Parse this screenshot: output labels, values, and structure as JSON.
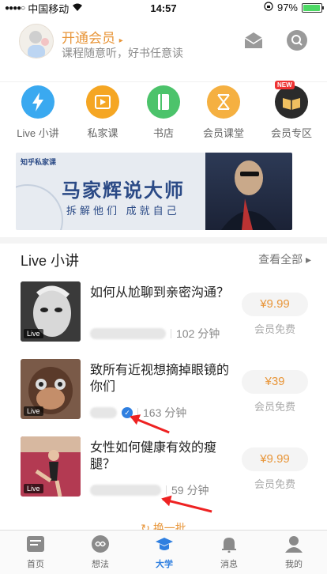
{
  "status_bar": {
    "signal": "●●●●○",
    "carrier": "中国移动",
    "time": "14:57",
    "battery": "97%"
  },
  "header": {
    "title": "开通会员",
    "subtitle": "课程随意听，好书任意读"
  },
  "shortcuts": [
    {
      "label": "Live 小讲",
      "color": "#3aa9f0"
    },
    {
      "label": "私家课",
      "color": "#f5a623"
    },
    {
      "label": "书店",
      "color": "#4cc36b"
    },
    {
      "label": "会员课堂",
      "color": "#f5b041"
    },
    {
      "label": "会员专区",
      "color": "#2b2b2b",
      "badge": "NEW"
    }
  ],
  "banner": {
    "logo": "知乎私家课",
    "title": "马家辉说大师",
    "subtitle": "拆解他们 成就自己"
  },
  "section": {
    "title": "Live 小讲",
    "view_all": "查看全部 ▸"
  },
  "items": [
    {
      "title": "如何从尬聊到亲密沟通？",
      "duration": "102 分钟",
      "price": "¥9.99",
      "note": "会员免费",
      "tag": "Live"
    },
    {
      "title": "致所有近视想摘掉眼镜的你们",
      "duration": "163 分钟",
      "price": "¥39",
      "note": "会员免费",
      "tag": "Live"
    },
    {
      "title": "女性如何健康有效的瘦腿？",
      "duration": "59 分钟",
      "price": "¥9.99",
      "note": "会员免费",
      "tag": "Live"
    }
  ],
  "refresh": "换一批",
  "tabs": [
    {
      "label": "首页"
    },
    {
      "label": "想法"
    },
    {
      "label": "大学"
    },
    {
      "label": "消息"
    },
    {
      "label": "我的"
    }
  ]
}
